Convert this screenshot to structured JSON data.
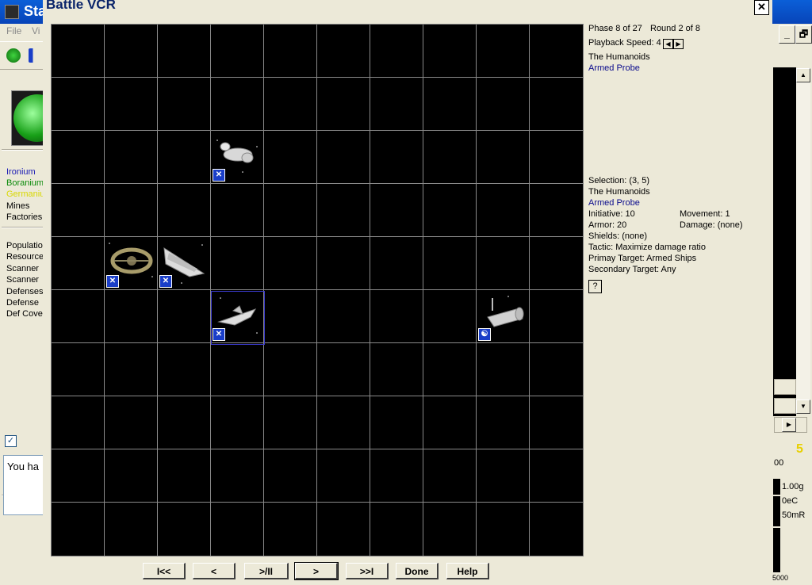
{
  "main_window": {
    "title": "Sta",
    "menus": [
      "File",
      "Vi"
    ],
    "left_panel": {
      "minerals": [
        {
          "label": "Ironium",
          "color": "#1a1ab4"
        },
        {
          "label": "Boranium",
          "color": "#0a8a0a"
        },
        {
          "label": "Germanium",
          "color": "#d8d800"
        }
      ],
      "stats_a": [
        "Mines",
        "Factories"
      ],
      "stats_b": [
        "Populatio",
        "Resource",
        "Scanner",
        "Scanner",
        "Defenses",
        "Defense",
        "Def Cove"
      ]
    },
    "message_text": "You ha",
    "right_panel": {
      "value_00": "00",
      "gravity": "1.00g",
      "temperature": "0eC",
      "radiation": "50mR",
      "bottom_value": "5000",
      "alert_number": "5"
    }
  },
  "dialog": {
    "title": "Battle VCR",
    "phase_text": "Phase 8 of 27",
    "round_text": "Round 2 of 8",
    "playback_label": "Playback Speed: 4",
    "top_race": "The Humanoids",
    "top_design": "Armed Probe",
    "selection_text": "Selection:  (3, 5)",
    "sel_race": "The Humanoids",
    "sel_design": "Armed Probe",
    "initiative": "Initiative: 10",
    "movement": "Movement: 1",
    "armor": "Armor: 20",
    "damage": "Damage: (none)",
    "shields": "Shields: (none)",
    "tactic": "Tactic: Maximize damage ratio",
    "primary_target": "Primay Target: Armed Ships",
    "secondary_target": "Secondary Target: Any",
    "help_q": "?",
    "buttons": {
      "first": "I<<",
      "back": "<",
      "play_pause": ">/II",
      "forward": ">",
      "last": ">>I",
      "done": "Done",
      "help": "Help"
    },
    "colors": {
      "grid_line": "#8a8a8a",
      "selection": "#3a3acc",
      "owner_badge": "#1a3ec8",
      "race_link": "#0a0a8c"
    }
  }
}
